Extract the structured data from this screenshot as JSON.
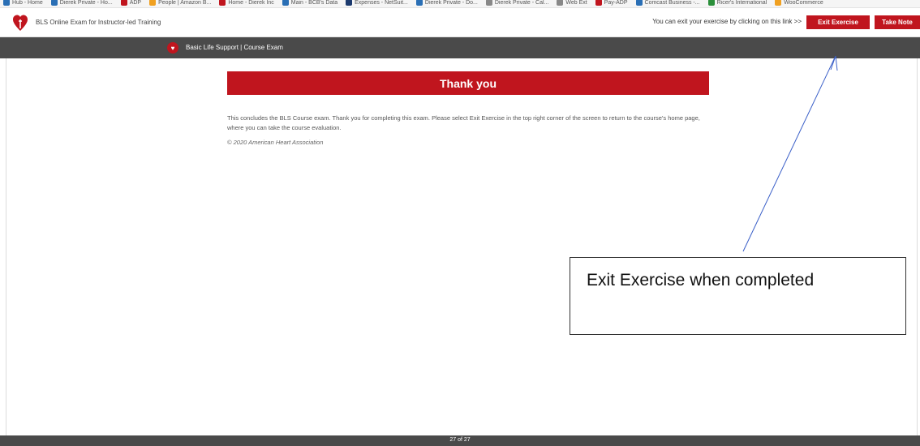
{
  "bookmarks": [
    {
      "label": "Hub - Home",
      "color": "#2a6fb5"
    },
    {
      "label": "Dierek Private - Ho...",
      "color": "#2a6fb5"
    },
    {
      "label": "ADP",
      "color": "#c0151e"
    },
    {
      "label": "People | Amazon B...",
      "color": "#f0a020"
    },
    {
      "label": "Home - Dierek Inc",
      "color": "#c0151e"
    },
    {
      "label": "Main - BCB's Data",
      "color": "#2a6fb5"
    },
    {
      "label": "Expenses - NetSuit...",
      "color": "#1c3a6e"
    },
    {
      "label": "Dierek Private - Do...",
      "color": "#2a6fb5"
    },
    {
      "label": "Dierek Private - Cal...",
      "color": "#888888"
    },
    {
      "label": "Web Ext",
      "color": "#888888"
    },
    {
      "label": "Pay-ADP",
      "color": "#c0151e"
    },
    {
      "label": "Comcast Business -...",
      "color": "#2a6fb5"
    },
    {
      "label": "Ricer's International",
      "color": "#2a8f3a"
    },
    {
      "label": "WooCommerce",
      "color": "#f0a020"
    }
  ],
  "header": {
    "app_title": "BLS Online Exam for Instructor-led Training",
    "exit_hint": "You can exit your exercise by clicking on this link >>",
    "exit_button": "Exit Exercise",
    "note_button": "Take Note"
  },
  "course_bar": {
    "title": "Basic Life Support | Course Exam"
  },
  "content": {
    "banner": "Thank you",
    "body": "This concludes the BLS Course exam. Thank you for completing this exam. Please select Exit Exercise in the top right corner of the screen to return to the course's home page, where you can take the course evaluation.",
    "copyright": "© 2020 American Heart Association"
  },
  "footer": {
    "page_count": "27 of 27"
  },
  "annotation": {
    "text": "Exit Exercise when completed"
  },
  "colors": {
    "brand_red": "#c0151e",
    "bar_gray": "#4a4a4a",
    "arrow_blue": "#3a5fc8"
  }
}
